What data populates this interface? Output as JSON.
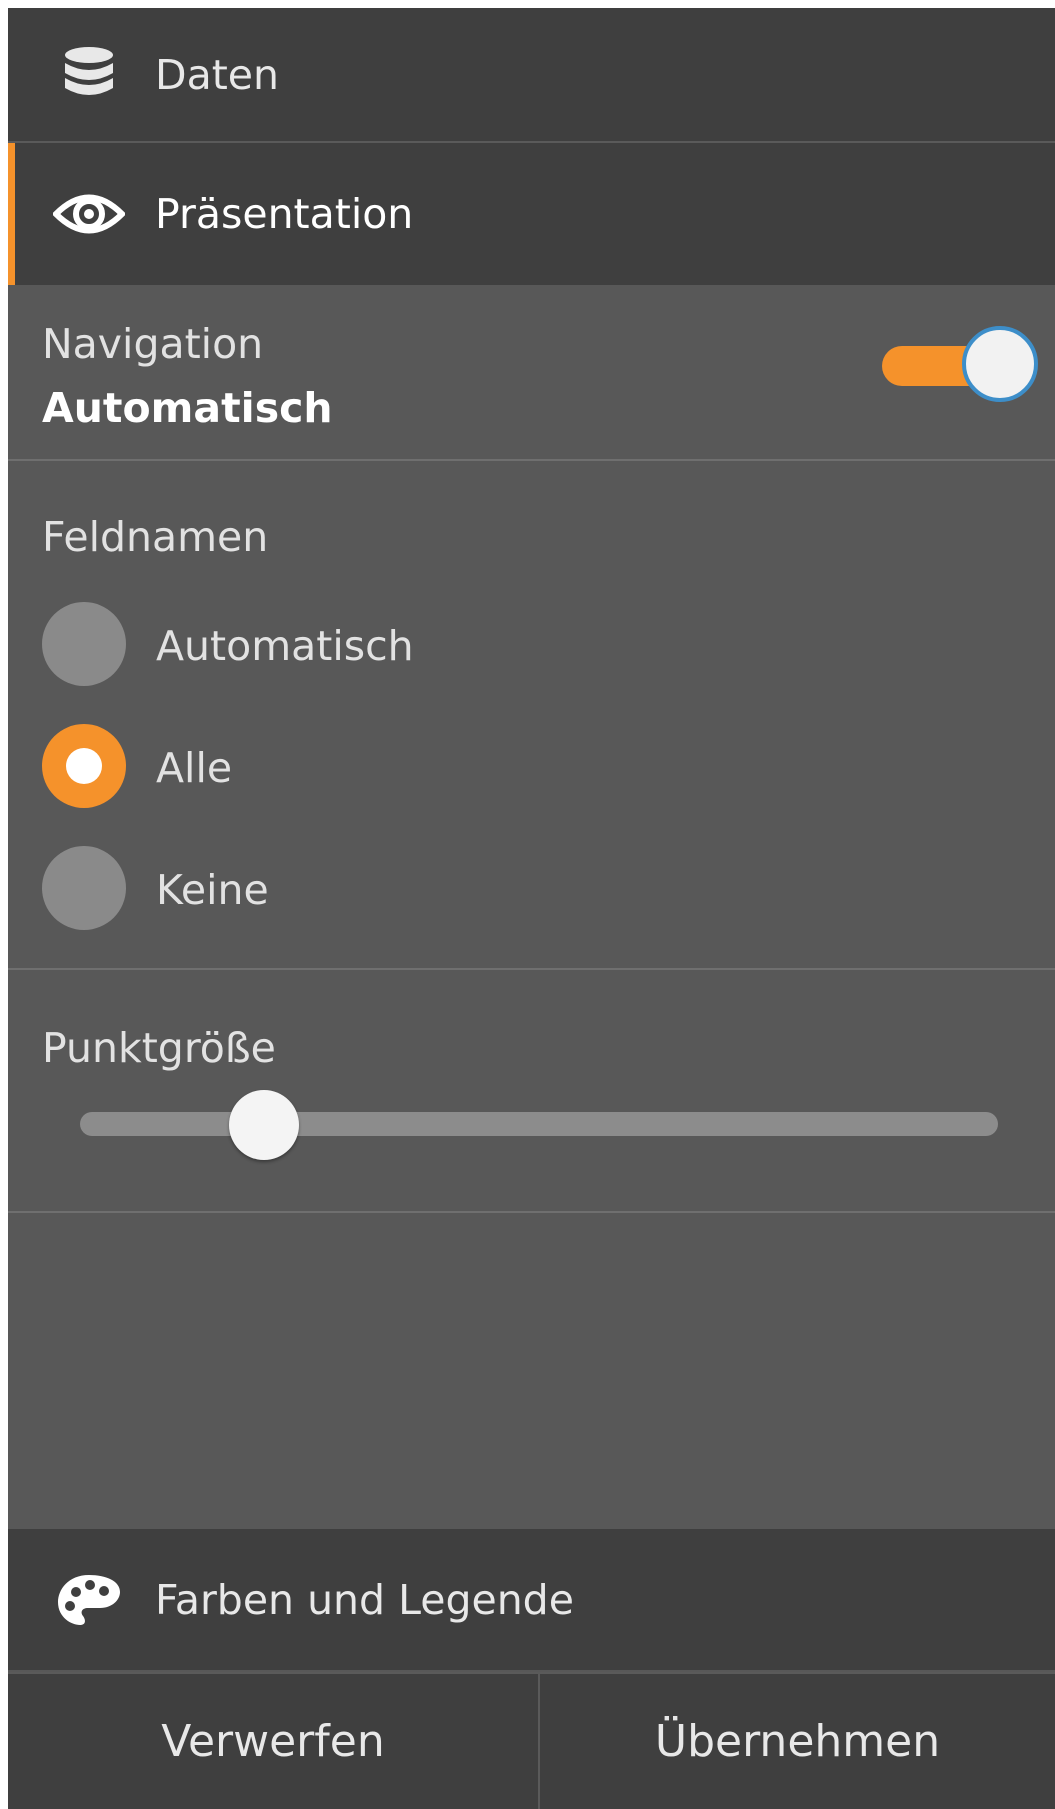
{
  "sections": {
    "data": {
      "label": "Daten",
      "icon": "database-icon"
    },
    "presentation": {
      "label": "Präsentation",
      "icon": "eye-icon",
      "active": true
    },
    "colors": {
      "label": "Farben und Legende",
      "icon": "palette-icon"
    }
  },
  "navigation": {
    "label": "Navigation",
    "value": "Automatisch",
    "toggle_on": true
  },
  "field_names": {
    "label": "Feldnamen",
    "options": [
      "Automatisch",
      "Alle",
      "Keine"
    ],
    "selected": "Alle"
  },
  "point_size": {
    "label": "Punktgröße",
    "value_fraction": 0.2
  },
  "footer": {
    "discard_label": "Verwerfen",
    "apply_label": "Übernehmen"
  },
  "colors": {
    "accent": "#f5922b",
    "panel_bg": "#585858",
    "header_bg": "#3f3f3f",
    "focus_ring": "#3d8ec9"
  }
}
